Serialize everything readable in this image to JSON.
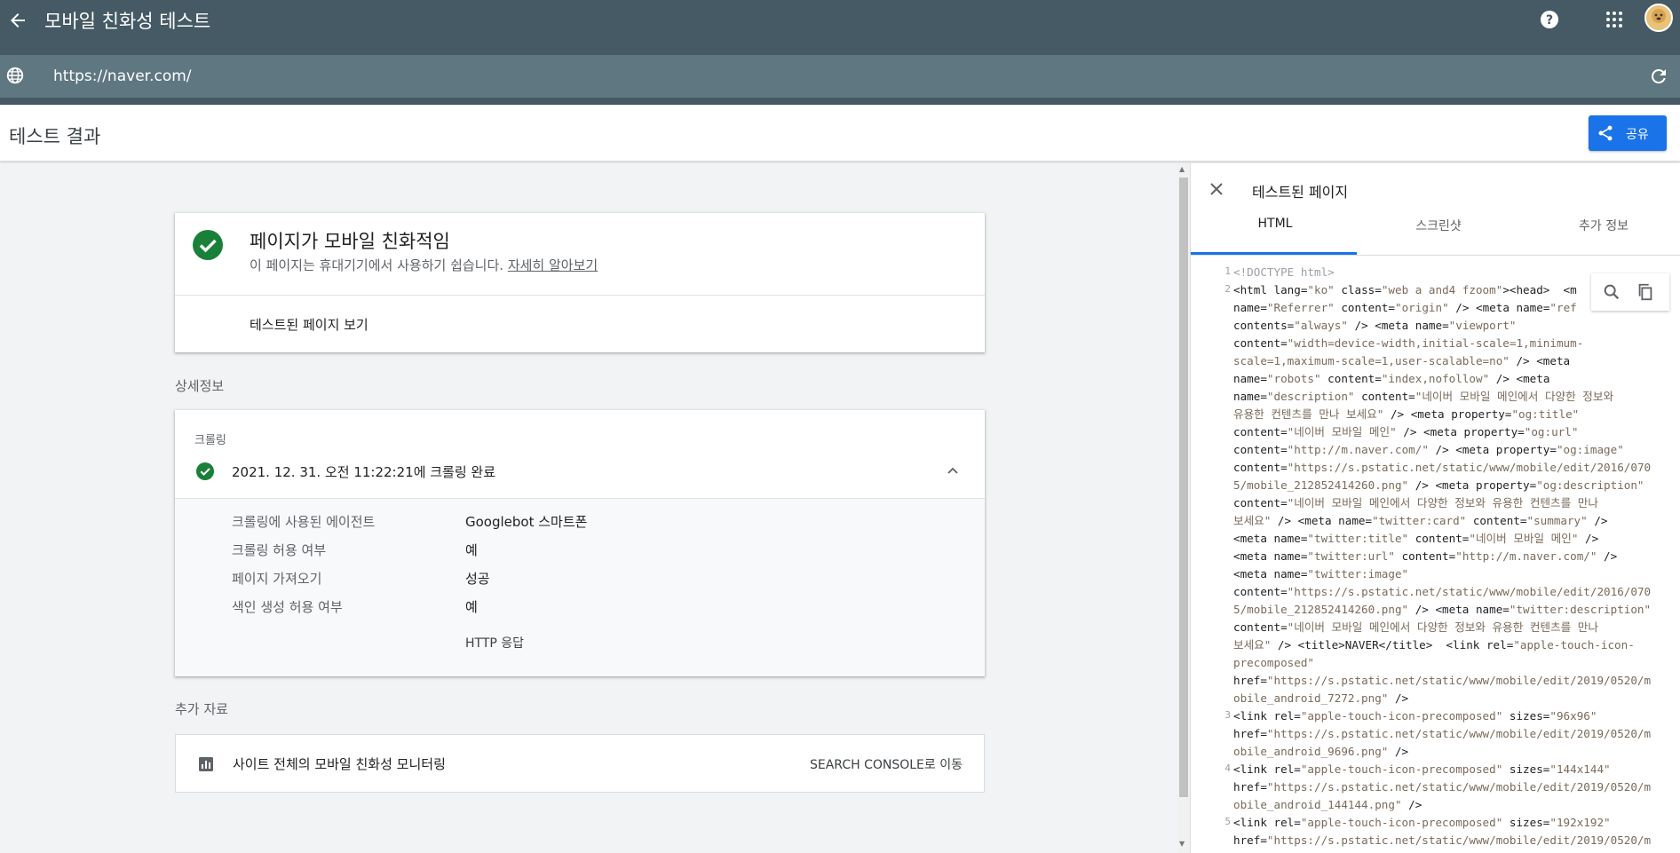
{
  "app": {
    "title": "모바일 친화성 테스트",
    "url": "https://naver.com/"
  },
  "result_bar": {
    "title": "테스트 결과",
    "share_label": "공유"
  },
  "summary": {
    "title": "페이지가 모바일 친화적임",
    "subtitle": "이 페이지는 휴대기기에서 사용하기 쉽습니다.",
    "learn_more": "자세히 알아보기",
    "view_tested": "테스트된 페이지 보기"
  },
  "details": {
    "heading": "상세정보",
    "crawl_title": "크롤링",
    "crawl_status": "2021. 12. 31. 오전 11:22:21에 크롤링 완료",
    "rows": [
      {
        "label": "크롤링에 사용된 에이전트",
        "value": "Googlebot 스마트폰"
      },
      {
        "label": "크롤링 허용 여부",
        "value": "예"
      },
      {
        "label": "페이지 가져오기",
        "value": "성공"
      },
      {
        "label": "색인 생성 허용 여부",
        "value": "예"
      }
    ],
    "http_link": "HTTP 응답"
  },
  "resources": {
    "heading": "추가 자료",
    "item_label": "사이트 전체의 모바일 친화성 모니터링",
    "action": "SEARCH CONSOLE로 이동"
  },
  "panel": {
    "title": "테스트된 페이지",
    "tabs": [
      "HTML",
      "스크린샷",
      "추가 정보"
    ],
    "active_tab": "HTML"
  },
  "colors": {
    "header": "#455a64",
    "url_bar": "#5f7780",
    "share": "#1a73e8",
    "success": "#188038"
  },
  "icons": [
    "back-arrow-icon",
    "help-icon",
    "apps-icon",
    "avatar",
    "globe-icon",
    "refresh-icon",
    "share-icon",
    "check-circle-icon",
    "chevron-up-icon",
    "chart-icon",
    "close-icon",
    "search-icon",
    "copy-icon"
  ]
}
